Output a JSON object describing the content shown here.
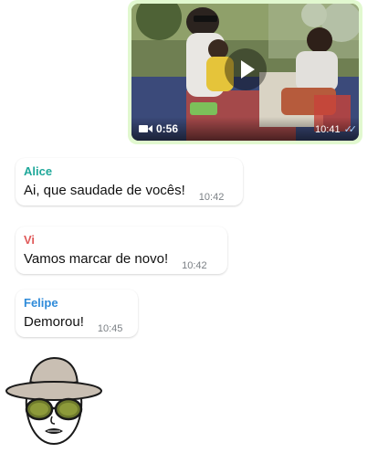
{
  "video_message": {
    "duration": "0:56",
    "time": "10:41",
    "status_icon": "double-check-icon"
  },
  "messages": [
    {
      "sender": "Alice",
      "sender_color": "#1fa89a",
      "text": "Ai, que saudade de vocês!",
      "time": "10:42"
    },
    {
      "sender": "Vi",
      "sender_color": "#e05a5a",
      "text": "Vamos marcar de novo!",
      "time": "10:42"
    },
    {
      "sender": "Felipe",
      "sender_color": "#2f8bd9",
      "text": "Demorou!",
      "time": "10:45"
    }
  ],
  "sticker": {
    "description_icon": "sunhat-sunglasses-face-sticker"
  },
  "colors": {
    "outgoing_bubble": "#e1f8cf",
    "incoming_bubble": "#ffffff",
    "time_text": "#7a7f84"
  }
}
